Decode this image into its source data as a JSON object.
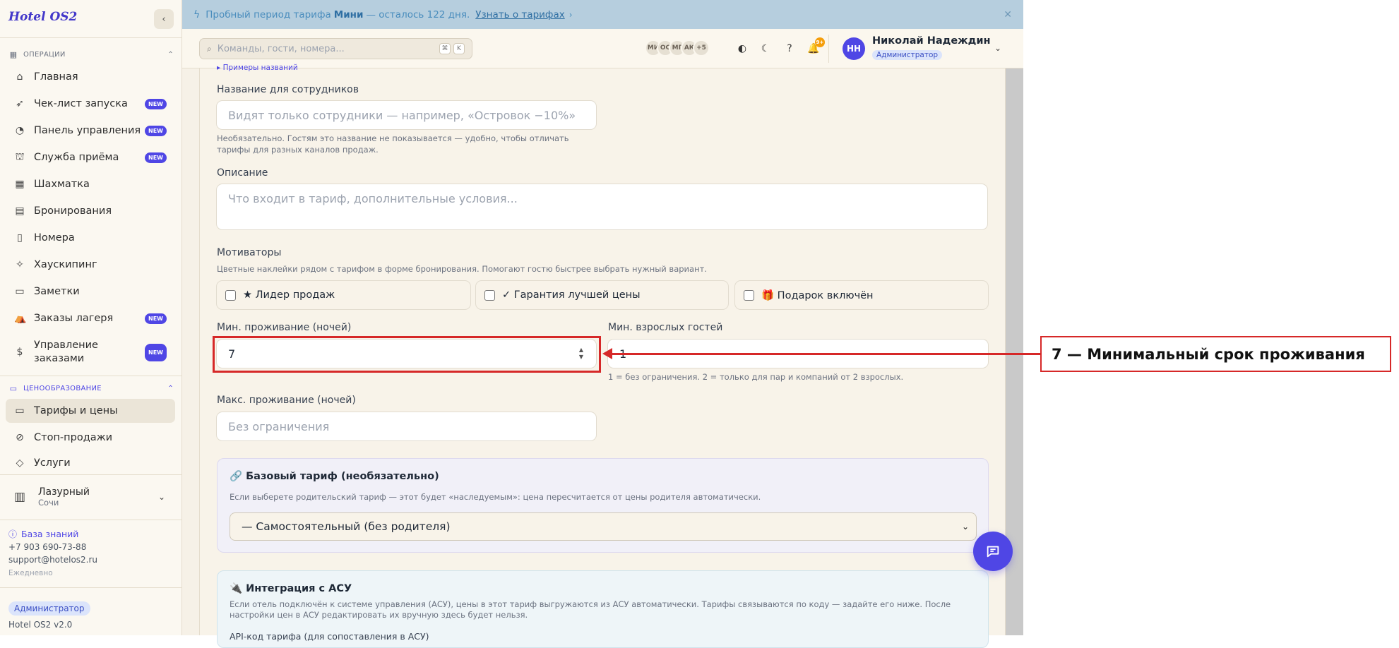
{
  "sidebar": {
    "brand": "Hotel OS2",
    "sections": {
      "operations": "ОПЕРАЦИИ",
      "pricing": "ЦЕНООБРАЗОВАНИЕ"
    },
    "items": [
      {
        "label": "Главная"
      },
      {
        "label": "Чек-лист запуска",
        "badge": "NEW"
      },
      {
        "label": "Панель управления",
        "badge": "NEW"
      },
      {
        "label": "Служба приёма",
        "badge": "NEW"
      },
      {
        "label": "Шахматка"
      },
      {
        "label": "Бронирования"
      },
      {
        "label": "Номера"
      },
      {
        "label": "Хаускипинг"
      },
      {
        "label": "Заметки"
      },
      {
        "label": "Заказы лагеря",
        "badge": "NEW"
      },
      {
        "label": "Управление заказами",
        "badge": "NEW"
      }
    ],
    "pricing_items": [
      {
        "label": "Тарифы и цены"
      },
      {
        "label": "Стоп-продажи"
      },
      {
        "label": "Услуги"
      }
    ],
    "hotel": {
      "name": "Лазурный",
      "city": "Сочи"
    },
    "knowledge_base": "База знаний",
    "phone": "+7 903 690-73-88",
    "email": "support@hotelos2.ru",
    "schedule": "Ежедневно",
    "role": "Администратор",
    "version": "Hotel OS2 v2.0"
  },
  "banner": {
    "text_before": "Пробный период тарифа",
    "plan": "Мини",
    "text_after": "— осталось 122 дня.",
    "link": "Узнать о тарифах"
  },
  "topbar": {
    "search_placeholder": "Команды, гости, номера...",
    "kbd_1": "⌘",
    "kbd_2": "K",
    "avatars": [
      "МИ",
      "ОС",
      "МГ",
      "АК",
      "+5"
    ],
    "notif_count": "9+",
    "user_initials": "НН",
    "user_name": "Николай Надеждин",
    "user_role": "Администратор"
  },
  "form": {
    "examples_link": "▸ Примеры названий",
    "staff_name_label": "Название для сотрудников",
    "staff_name_placeholder": "Видят только сотрудники — например, «Островок −10%»",
    "staff_name_help": "Необязательно. Гостям это название не показывается — удобно, чтобы отличать тарифы для разных каналов продаж.",
    "description_label": "Описание",
    "description_placeholder": "Что входит в тариф, дополнительные условия...",
    "motivators_label": "Мотиваторы",
    "motivators_help": "Цветные наклейки рядом с тарифом в форме бронирования. Помогают гостю быстрее выбрать нужный вариант.",
    "motivators": [
      "★ Лидер продаж",
      "✓ Гарантия лучшей цены",
      "🎁 Подарок включён"
    ],
    "min_stay_label": "Мин. проживание (ночей)",
    "min_stay_value": "7",
    "min_adults_label": "Мин. взрослых гостей",
    "min_adults_value": "1",
    "min_adults_help": "1 = без ограничения. 2 = только для пар и компаний от 2 взрослых.",
    "max_stay_label": "Макс. проживание (ночей)",
    "max_stay_placeholder": "Без ограничения",
    "base_title": "🔗 Базовый тариф (необязательно)",
    "base_help": "Если выберете родительский тариф — этот будет «наследуемым»: цена пересчитается от цены родителя автоматически.",
    "base_select": "— Самостоятельный (без родителя)",
    "asu_title": "🔌 Интеграция с АСУ",
    "asu_help": "Если отель подключён к системе управления (АСУ), цены в этот тариф выгружаются из АСУ автоматически. Тарифы связываются по коду — задайте его ниже. После настройки цен в АСУ редактировать их вручную здесь будет нельзя.",
    "asu_code_label": "API-код тарифа (для сопоставления в АСУ)"
  },
  "annotation": {
    "text": "7 — Минимальный срок проживания",
    "color": "#d62828"
  },
  "colors": {
    "accent": "#4f46e5",
    "banner_bg": "#b6cede"
  }
}
